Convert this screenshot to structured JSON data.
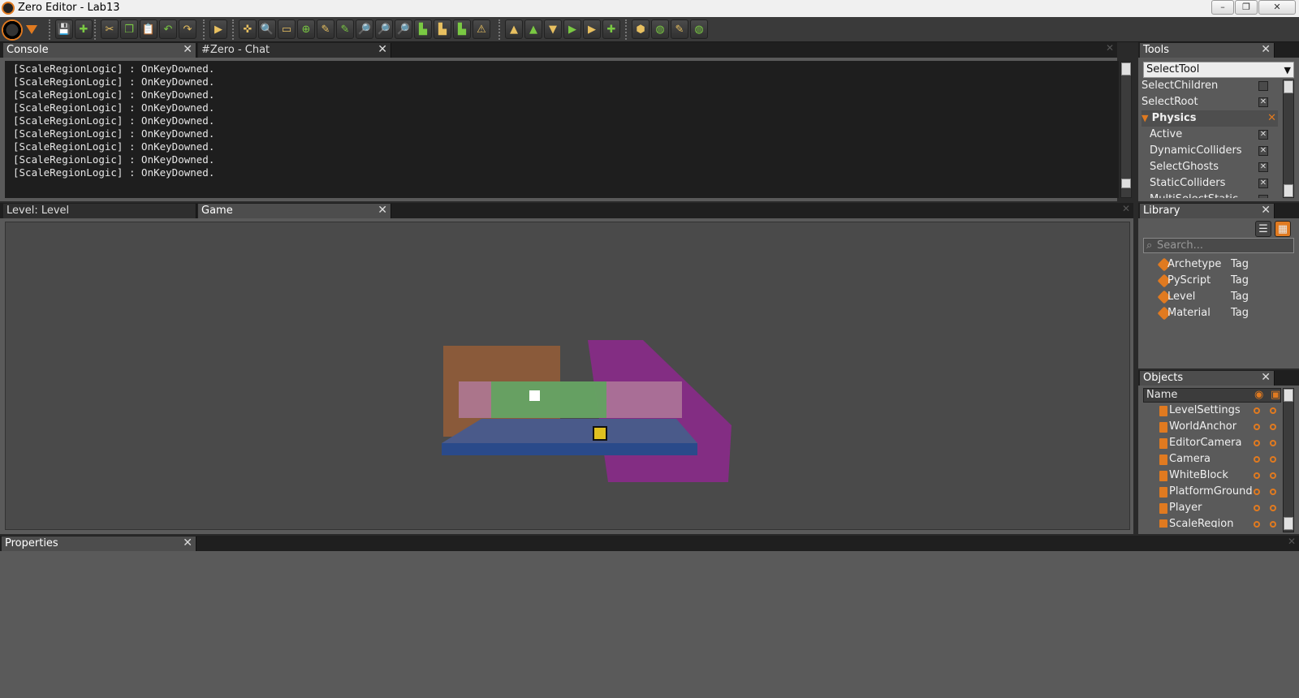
{
  "window": {
    "title": "Zero Editor - Lab13",
    "minimize": "–",
    "restore": "❐",
    "close": "✕"
  },
  "toolbar": {
    "groups": [
      [
        "💾",
        "✚"
      ],
      [
        "✂",
        "❐",
        "📋",
        "↶",
        "↷"
      ],
      [
        "▶"
      ],
      [
        "✜",
        "🔍",
        "▭",
        "⊕",
        "✎",
        "✎",
        "🔎",
        "🔎",
        "🔎",
        "▙",
        "▙",
        "▙",
        "⚠"
      ],
      [
        "▲",
        "▲",
        "▼",
        "▶",
        "▶",
        "✚"
      ],
      [
        "⬢",
        "◍",
        "✎",
        "◍"
      ]
    ]
  },
  "console": {
    "tabs": [
      {
        "label": "Console"
      },
      {
        "label": "#Zero - Chat"
      }
    ],
    "lines": [
      "[ScaleRegionLogic] : OnKeyDowned.",
      "[ScaleRegionLogic] : OnKeyDowned.",
      "[ScaleRegionLogic] : OnKeyDowned.",
      "[ScaleRegionLogic] : OnKeyDowned.",
      "[ScaleRegionLogic] : OnKeyDowned.",
      "[ScaleRegionLogic] : OnKeyDowned.",
      "[ScaleRegionLogic] : OnKeyDowned.",
      "[ScaleRegionLogic] : OnKeyDowned.",
      "[ScaleRegionLogic] : OnKeyDowned."
    ]
  },
  "viewport": {
    "tabs": [
      {
        "label": "Level: Level"
      },
      {
        "label": "Game"
      }
    ]
  },
  "tools": {
    "title": "Tools",
    "selected_tool": "SelectTool",
    "rows": [
      {
        "label": "SelectChildren",
        "checked": false,
        "indent": false
      },
      {
        "label": "SelectRoot",
        "checked": true,
        "indent": false
      }
    ],
    "section": "Physics",
    "physics_rows": [
      {
        "label": "Active",
        "checked": true
      },
      {
        "label": "DynamicColliders",
        "checked": true
      },
      {
        "label": "SelectGhosts",
        "checked": true
      },
      {
        "label": "StaticColliders",
        "checked": true
      },
      {
        "label": "MultiSelectStatic",
        "checked": false
      }
    ]
  },
  "library": {
    "title": "Library",
    "search_placeholder": "Search...",
    "items": [
      {
        "name": "Archetype",
        "type": "Tag"
      },
      {
        "name": "PyScript",
        "type": "Tag"
      },
      {
        "name": "Level",
        "type": "Tag"
      },
      {
        "name": "Material",
        "type": "Tag"
      }
    ]
  },
  "objects": {
    "title": "Objects",
    "column_name": "Name",
    "items": [
      "LevelSettings",
      "WorldAnchor",
      "EditorCamera",
      "Camera",
      "WhiteBlock",
      "PlatformGround",
      "Player",
      "ScaleRegion"
    ]
  },
  "properties": {
    "title": "Properties"
  },
  "colors": {
    "accent": "#e07a20",
    "panel": "#5a5a5a",
    "console_bg": "#1e1e1e"
  }
}
